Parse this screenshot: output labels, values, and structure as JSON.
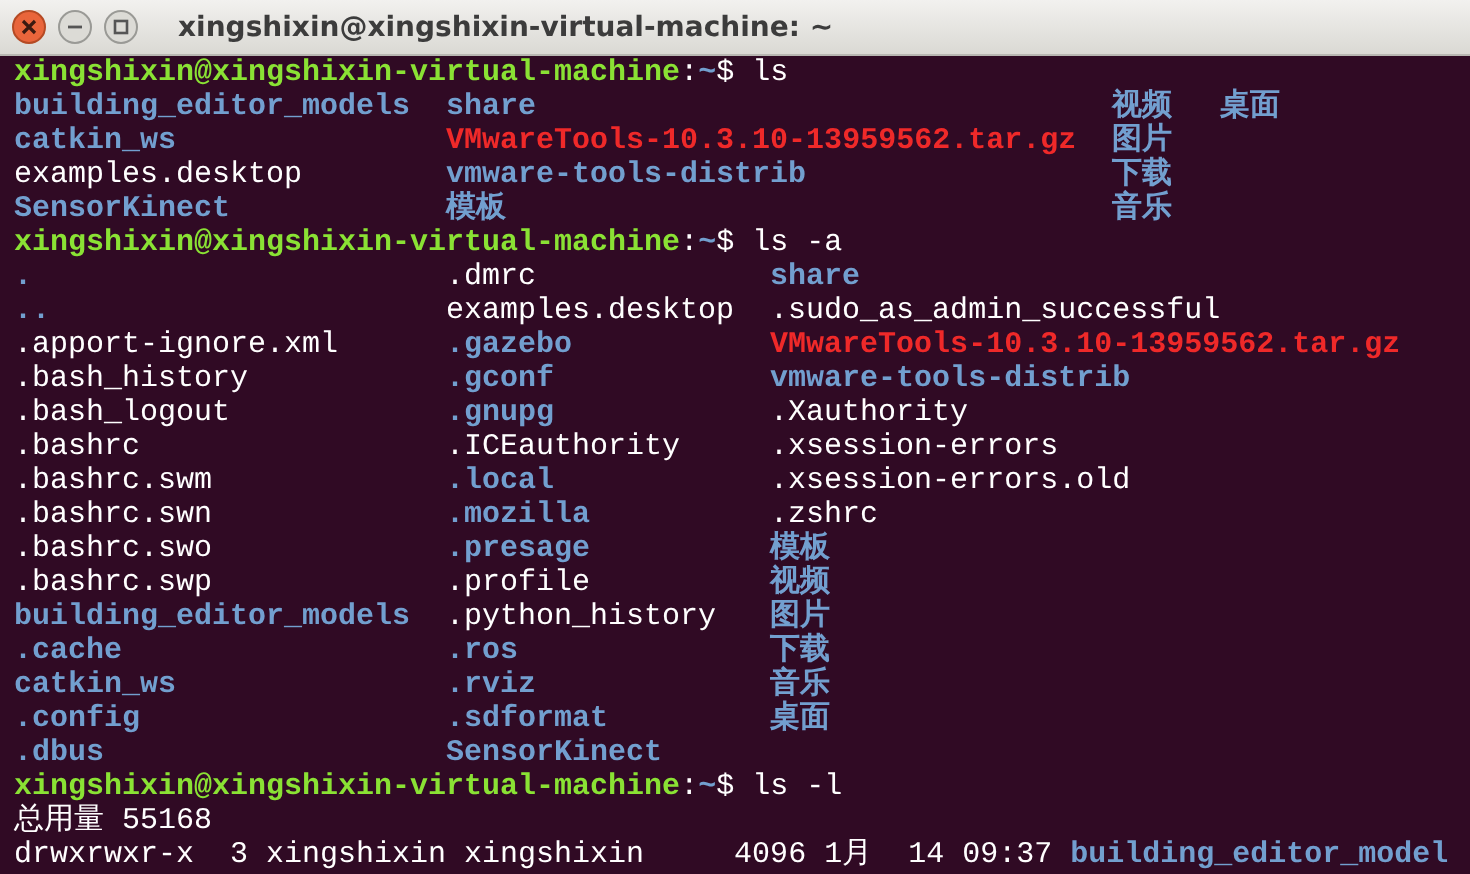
{
  "window": {
    "title": "xingshixin@xingshixin-virtual-machine: ~"
  },
  "lines": [
    {
      "kind": "prompt",
      "user_host": "xingshixin@xingshixin-virtual-machine",
      "separator": ":",
      "path": "~",
      "symbol": "$",
      "command": "ls"
    },
    {
      "kind": "grid",
      "columns": [
        [
          {
            "name": "building_editor_models",
            "kind": "dir"
          },
          {
            "name": "catkin_ws",
            "kind": "dir"
          },
          {
            "name": "examples.desktop",
            "kind": "file"
          },
          {
            "name": "SensorKinect",
            "kind": "dir"
          }
        ],
        [
          {
            "name": "share",
            "kind": "dir"
          },
          {
            "name": "VMwareTools-10.3.10-13959562.tar.gz",
            "kind": "archive"
          },
          {
            "name": "vmware-tools-distrib",
            "kind": "dir"
          },
          {
            "name": "模板",
            "kind": "dir"
          }
        ],
        [
          {
            "name": "视频",
            "kind": "dir"
          },
          {
            "name": "图片",
            "kind": "dir"
          },
          {
            "name": "下载",
            "kind": "dir"
          },
          {
            "name": "音乐",
            "kind": "dir"
          }
        ],
        [
          {
            "name": "桌面",
            "kind": "dir"
          }
        ]
      ]
    },
    {
      "kind": "prompt",
      "user_host": "xingshixin@xingshixin-virtual-machine",
      "separator": ":",
      "path": "~",
      "symbol": "$",
      "command": "ls -a"
    },
    {
      "kind": "grid",
      "columns": [
        [
          {
            "name": ".",
            "kind": "dir"
          },
          {
            "name": "..",
            "kind": "dir"
          },
          {
            "name": ".apport-ignore.xml",
            "kind": "file"
          },
          {
            "name": ".bash_history",
            "kind": "file"
          },
          {
            "name": ".bash_logout",
            "kind": "file"
          },
          {
            "name": ".bashrc",
            "kind": "file"
          },
          {
            "name": ".bashrc.swm",
            "kind": "file"
          },
          {
            "name": ".bashrc.swn",
            "kind": "file"
          },
          {
            "name": ".bashrc.swo",
            "kind": "file"
          },
          {
            "name": ".bashrc.swp",
            "kind": "file"
          },
          {
            "name": "building_editor_models",
            "kind": "dir"
          },
          {
            "name": ".cache",
            "kind": "dir"
          },
          {
            "name": "catkin_ws",
            "kind": "dir"
          },
          {
            "name": ".config",
            "kind": "dir"
          },
          {
            "name": ".dbus",
            "kind": "dir"
          }
        ],
        [
          {
            "name": ".dmrc",
            "kind": "file"
          },
          {
            "name": "examples.desktop",
            "kind": "file"
          },
          {
            "name": ".gazebo",
            "kind": "dir"
          },
          {
            "name": ".gconf",
            "kind": "dir"
          },
          {
            "name": ".gnupg",
            "kind": "dir"
          },
          {
            "name": ".ICEauthority",
            "kind": "file"
          },
          {
            "name": ".local",
            "kind": "dir"
          },
          {
            "name": ".mozilla",
            "kind": "dir"
          },
          {
            "name": ".presage",
            "kind": "dir"
          },
          {
            "name": ".profile",
            "kind": "file"
          },
          {
            "name": ".python_history",
            "kind": "file"
          },
          {
            "name": ".ros",
            "kind": "dir"
          },
          {
            "name": ".rviz",
            "kind": "dir"
          },
          {
            "name": ".sdformat",
            "kind": "dir"
          },
          {
            "name": "SensorKinect",
            "kind": "dir"
          }
        ],
        [
          {
            "name": "share",
            "kind": "dir"
          },
          {
            "name": ".sudo_as_admin_successful",
            "kind": "file"
          },
          {
            "name": "VMwareTools-10.3.10-13959562.tar.gz",
            "kind": "archive"
          },
          {
            "name": "vmware-tools-distrib",
            "kind": "dir"
          },
          {
            "name": ".Xauthority",
            "kind": "file"
          },
          {
            "name": ".xsession-errors",
            "kind": "file"
          },
          {
            "name": ".xsession-errors.old",
            "kind": "file"
          },
          {
            "name": ".zshrc",
            "kind": "file"
          },
          {
            "name": "模板",
            "kind": "dir"
          },
          {
            "name": "视频",
            "kind": "dir"
          },
          {
            "name": "图片",
            "kind": "dir"
          },
          {
            "name": "下载",
            "kind": "dir"
          },
          {
            "name": "音乐",
            "kind": "dir"
          },
          {
            "name": "桌面",
            "kind": "dir"
          }
        ]
      ]
    },
    {
      "kind": "prompt",
      "user_host": "xingshixin@xingshixin-virtual-machine",
      "separator": ":",
      "path": "~",
      "symbol": "$",
      "command": "ls -l"
    },
    {
      "kind": "text",
      "segments": [
        {
          "text": "总用量 55168",
          "kind": "file"
        }
      ]
    },
    {
      "kind": "text",
      "segments": [
        {
          "text": "drwxrwxr-x  3 xingshixin xingshixin     4096 1月  14 09:37 ",
          "kind": "file"
        },
        {
          "text": "building_editor_model",
          "kind": "dir"
        }
      ]
    }
  ]
}
